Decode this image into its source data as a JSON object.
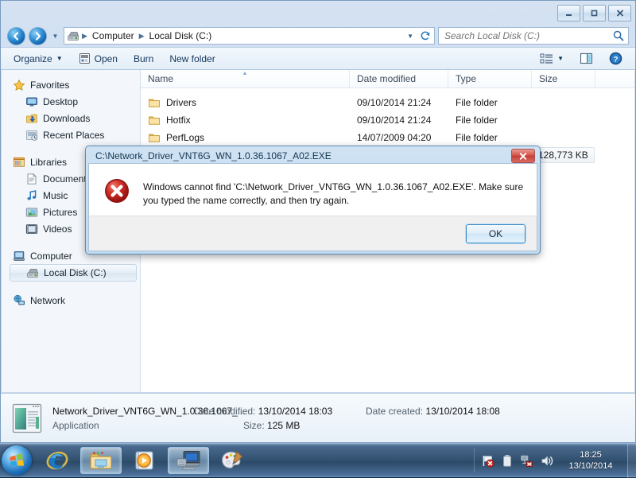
{
  "window": {
    "titlebar_buttons": [
      {
        "name": "minimize",
        "label": "Minimize"
      },
      {
        "name": "maximize",
        "label": "Maximize"
      },
      {
        "name": "close",
        "label": "Close"
      }
    ]
  },
  "address_bar": {
    "back_label": "Back",
    "forward_label": "Forward",
    "history_label": "Recent pages",
    "drive_icon": "hard-disk-icon",
    "crumbs": [
      "Computer",
      "Local Disk (C:)"
    ],
    "dropdown_label": "Previous locations",
    "refresh_label": "Refresh"
  },
  "search": {
    "placeholder": "Search Local Disk (C:)",
    "value": "",
    "icon": "search-icon"
  },
  "toolbar": {
    "organize_label": "Organize",
    "open_label": "Open",
    "burn_label": "Burn",
    "new_folder_label": "New folder",
    "views_label": "Change your view",
    "views_caret": "More options",
    "preview_label": "Show the preview pane",
    "help_label": "Get help"
  },
  "nav_pane": {
    "groups": [
      {
        "header": {
          "label": "Favorites",
          "icon": "star-icon"
        },
        "items": [
          {
            "label": "Desktop",
            "icon": "desktop-icon"
          },
          {
            "label": "Downloads",
            "icon": "downloads-icon"
          },
          {
            "label": "Recent Places",
            "icon": "recent-places-icon"
          }
        ]
      },
      {
        "header": {
          "label": "Libraries",
          "icon": "libraries-icon"
        },
        "items": [
          {
            "label": "Documents",
            "icon": "document-icon"
          },
          {
            "label": "Music",
            "icon": "music-icon"
          },
          {
            "label": "Pictures",
            "icon": "pictures-icon"
          },
          {
            "label": "Videos",
            "icon": "video-icon"
          }
        ]
      },
      {
        "header": {
          "label": "Computer",
          "icon": "computer-icon"
        },
        "items": [
          {
            "label": "Local Disk (C:)",
            "icon": "hard-disk-icon",
            "selected": true
          }
        ]
      },
      {
        "header": {
          "label": "Network",
          "icon": "network-icon"
        },
        "items": []
      }
    ]
  },
  "file_list": {
    "columns": [
      {
        "label": "Name",
        "sorted": true
      },
      {
        "label": "Date modified",
        "sorted": false
      },
      {
        "label": "Type",
        "sorted": false
      },
      {
        "label": "Size",
        "sorted": false
      }
    ],
    "rows": [
      {
        "name": "Drivers",
        "date_modified": "09/10/2014 21:24",
        "type": "File folder",
        "size": "",
        "icon": "folder-icon"
      },
      {
        "name": "Hotfix",
        "date_modified": "09/10/2014 21:24",
        "type": "File folder",
        "size": "",
        "icon": "folder-icon"
      },
      {
        "name": "PerfLogs",
        "date_modified": "14/07/2009 04:20",
        "type": "File folder",
        "size": "",
        "icon": "folder-icon"
      }
    ],
    "selected_size": "128,773 KB"
  },
  "details_pane": {
    "file_name": "Network_Driver_VNT6G_WN_1.0.36.1067_...",
    "file_type": "Application",
    "icon": "application-icon",
    "date_modified_label": "Date modified:",
    "date_modified_value": "13/10/2014 18:03",
    "size_label": "Size:",
    "size_value": "125 MB",
    "date_created_label": "Date created:",
    "date_created_value": "13/10/2014 18:08"
  },
  "error_dialog": {
    "title": "C:\\Network_Driver_VNT6G_WN_1.0.36.1067_A02.EXE",
    "close_label": "Close",
    "icon": "error-icon",
    "message": "Windows cannot find 'C:\\Network_Driver_VNT6G_WN_1.0.36.1067_A02.EXE'. Make sure you typed the name correctly, and then try again.",
    "ok_label": "OK"
  },
  "taskbar": {
    "start_label": "Start",
    "items": [
      {
        "name": "internet-explorer",
        "label": "Internet Explorer",
        "active": false
      },
      {
        "name": "windows-explorer",
        "label": "Windows Explorer",
        "active": true
      },
      {
        "name": "windows-media-player",
        "label": "Windows Media Player",
        "active": false
      },
      {
        "name": "remote-desktop",
        "label": "Remote Desktop",
        "active": true
      },
      {
        "name": "paint",
        "label": "Paint",
        "active": false
      }
    ],
    "tray": [
      {
        "name": "action-center",
        "label": "Action Center - problem found"
      },
      {
        "name": "battery",
        "label": "Battery"
      },
      {
        "name": "network",
        "label": "Network - no connection"
      },
      {
        "name": "volume",
        "label": "Volume"
      }
    ],
    "clock_time": "18:25",
    "clock_date": "13/10/2014",
    "show_desktop_label": "Show desktop"
  },
  "colors": {
    "accent": "#3c87c4",
    "error_red": "#c23f36",
    "taskbar": "#31506f",
    "window_chrome": "#cbdcee"
  }
}
